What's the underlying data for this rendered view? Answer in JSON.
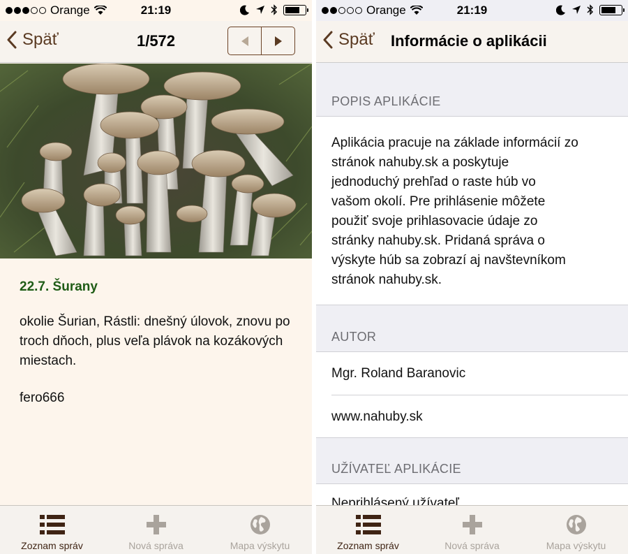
{
  "colors": {
    "accent_brown": "#5a3a22",
    "heading_green": "#1f5c16",
    "left_background": "#fdf5ec",
    "section_gray": "#efeff4",
    "tab_inactive": "#a9a39c",
    "tab_active": "#3f2414"
  },
  "left": {
    "status": {
      "carrier": "Orange",
      "time": "21:19"
    },
    "nav": {
      "back_label": "Späť",
      "counter": "1/572",
      "prev_icon": "triangle-left-icon",
      "next_icon": "triangle-right-icon"
    },
    "photo": {
      "subject": "mushrooms-photo"
    },
    "post": {
      "heading": "22.7. Šurany",
      "text": "okolie Šurian, Rástli: dnešný úlovok, znovu po troch dňoch, plus veľa plávok na kozákových miestach.",
      "author": "fero666"
    },
    "tabs": [
      {
        "label": "Zoznam správ",
        "icon": "list-icon",
        "active": true
      },
      {
        "label": "Nová správa",
        "icon": "plus-icon",
        "active": false
      },
      {
        "label": "Mapa výskytu",
        "icon": "globe-icon",
        "active": false
      }
    ]
  },
  "right": {
    "status": {
      "carrier": "Orange",
      "time": "21:19"
    },
    "nav": {
      "back_label": "Späť",
      "title": "Informácie o aplikácii"
    },
    "sections": {
      "description": {
        "header": "POPIS APLIKÁCIE",
        "lines": [
          "Aplikácia pracuje na základe informácií zo",
          "stránok nahuby.sk a poskytuje",
          "jednoduchý prehľad o raste húb vo",
          "vašom okolí. Pre prihlásenie môžete",
          "použiť svoje prihlasovacie údaje zo",
          "stránky nahuby.sk. Pridaná správa o",
          "výskyte húb sa zobrazí aj navštevníkom",
          "stránok nahuby.sk."
        ]
      },
      "author": {
        "header": "AUTOR",
        "name": "Mgr. Roland Baranovic",
        "website": "www.nahuby.sk"
      },
      "user": {
        "header": "UŽÍVATEĽ APLIKÁCIE",
        "status": "Neprihlásený užívateľ"
      }
    },
    "tabs": [
      {
        "label": "Zoznam správ",
        "icon": "list-icon",
        "active": true
      },
      {
        "label": "Nová správa",
        "icon": "plus-icon",
        "active": false
      },
      {
        "label": "Mapa výskytu",
        "icon": "globe-icon",
        "active": false
      }
    ]
  }
}
